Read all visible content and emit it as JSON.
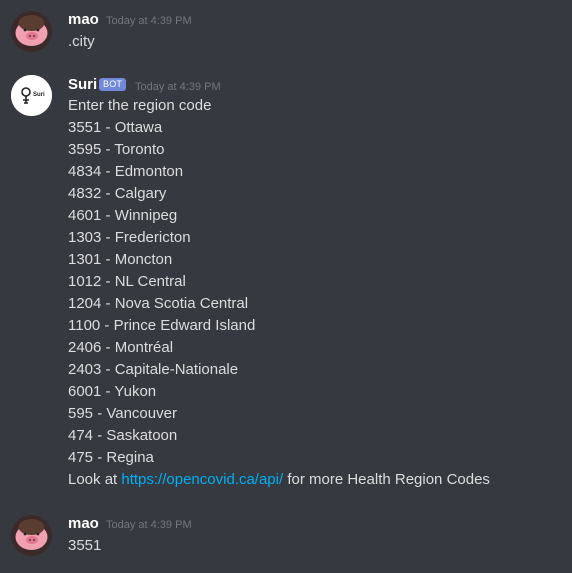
{
  "messages": [
    {
      "author": "mao",
      "timestamp": "Today at 4:39 PM",
      "text": ".city"
    },
    {
      "author": "Suri",
      "badge": "BOT",
      "avatar_text": "Suri",
      "timestamp": "Today at 4:39 PM",
      "lines": [
        "Enter the region code",
        "3551 - Ottawa",
        "3595 - Toronto",
        "4834 - Edmonton",
        "4832 - Calgary",
        "4601 - Winnipeg",
        "1303 - Fredericton",
        "1301 - Moncton",
        "1012 - NL Central",
        "1204 - Nova Scotia Central",
        "1100 - Prince Edward Island",
        "2406 - Montréal",
        "2403 - Capitale-Nationale",
        "6001 - Yukon",
        "595 - Vancouver",
        "474 - Saskatoon",
        "475 - Regina"
      ],
      "footer_prefix": "Look at ",
      "footer_link": "https://opencovid.ca/api/",
      "footer_suffix": " for more Health Region Codes"
    },
    {
      "author": "mao",
      "timestamp": "Today at 4:39 PM",
      "text": "3551"
    }
  ],
  "colors": {
    "background": "#36393f",
    "username": "#ffffff",
    "text": "#dcddde",
    "timestamp": "#72767d",
    "bot_badge": "#7289da",
    "link": "#00b0f4"
  }
}
